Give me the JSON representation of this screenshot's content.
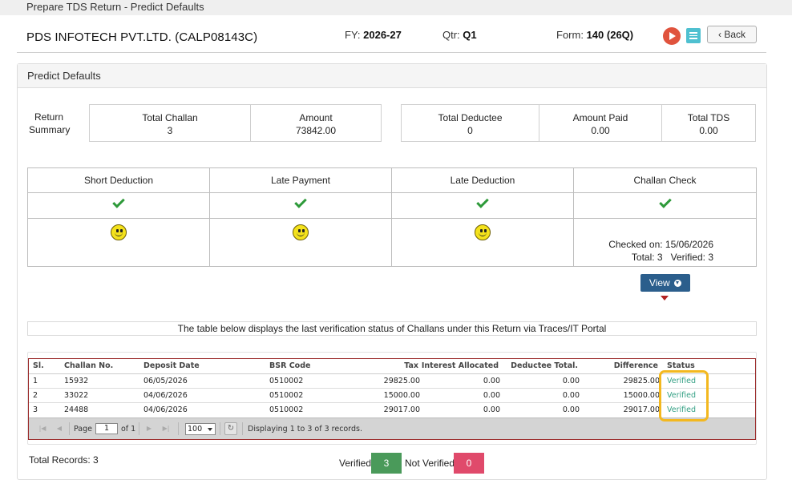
{
  "window": {
    "title": "Prepare TDS Return - Predict Defaults"
  },
  "header": {
    "company": "PDS INFOTECH PVT.LTD. (CALP08143C)",
    "fy_label": "FY:",
    "fy_value": "2026-27",
    "qtr_label": "Qtr:",
    "qtr_value": "Q1",
    "form_label": "Form:",
    "form_value": "140 (26Q)",
    "back_label": "Back",
    "icons": {
      "play": "play-icon",
      "doc": "document-icon",
      "back": "chevron-left-icon"
    },
    "colors": {
      "play": "#e0533d",
      "doc": "#4fc0d0"
    }
  },
  "panel": {
    "title": "Predict Defaults"
  },
  "return_summary": {
    "label": "Return Summary",
    "total_challan_label": "Total Challan",
    "total_challan": "3",
    "amount_label": "Amount",
    "amount": "73842.00",
    "total_deductee_label": "Total Deductee",
    "total_deductee": "0",
    "amount_paid_label": "Amount Paid",
    "amount_paid": "0.00",
    "total_tds_label": "Total TDS",
    "total_tds": "0.00"
  },
  "checks": {
    "headers": [
      "Short Deduction",
      "Late Payment",
      "Late Deduction",
      "Challan Check"
    ],
    "status_icons": [
      "check-icon",
      "check-icon",
      "check-icon",
      "check-icon"
    ],
    "result_icons": [
      "smiley-icon",
      "smiley-icon",
      "smiley-icon"
    ],
    "challan_check": {
      "checked_on": "Checked on: 15/06/2026",
      "total": "Total: 3",
      "verified": "Verified: 3"
    }
  },
  "view_button": {
    "label": "View"
  },
  "info_text": "The table below displays the last verification status of Challans under this Return via Traces/IT Portal",
  "grid": {
    "columns": [
      "Sl.",
      "Challan No.",
      "Deposit Date",
      "BSR Code",
      "Tax",
      "Interest Allocated",
      "Deductee Total.",
      "Difference",
      "Status"
    ],
    "rows": [
      {
        "sl": "1",
        "challan_no": "15932",
        "deposit_date": "06/05/2026",
        "bsr_code": "0510002",
        "tax": "29825.00",
        "interest": "0.00",
        "deductee_total": "0.00",
        "difference": "29825.00",
        "status": "Verified"
      },
      {
        "sl": "2",
        "challan_no": "33022",
        "deposit_date": "04/06/2026",
        "bsr_code": "0510002",
        "tax": "15000.00",
        "interest": "0.00",
        "deductee_total": "0.00",
        "difference": "15000.00",
        "status": "Verified"
      },
      {
        "sl": "3",
        "challan_no": "24488",
        "deposit_date": "04/06/2026",
        "bsr_code": "0510002",
        "tax": "29017.00",
        "interest": "0.00",
        "deductee_total": "0.00",
        "difference": "29017.00",
        "status": "Verified"
      }
    ],
    "pager": {
      "page_label": "Page",
      "page_value": "1",
      "of_label": "of 1",
      "page_size": "100",
      "display_text": "Displaying 1 to 3 of 3 records."
    }
  },
  "footer": {
    "total_records": "Total Records: 3",
    "verified_label": "Verified",
    "verified_count": "3",
    "not_verified_label": "Not Verified",
    "not_verified_count": "0",
    "colors": {
      "verified": "#4a9a5a",
      "not_verified": "#e04a6b"
    }
  }
}
